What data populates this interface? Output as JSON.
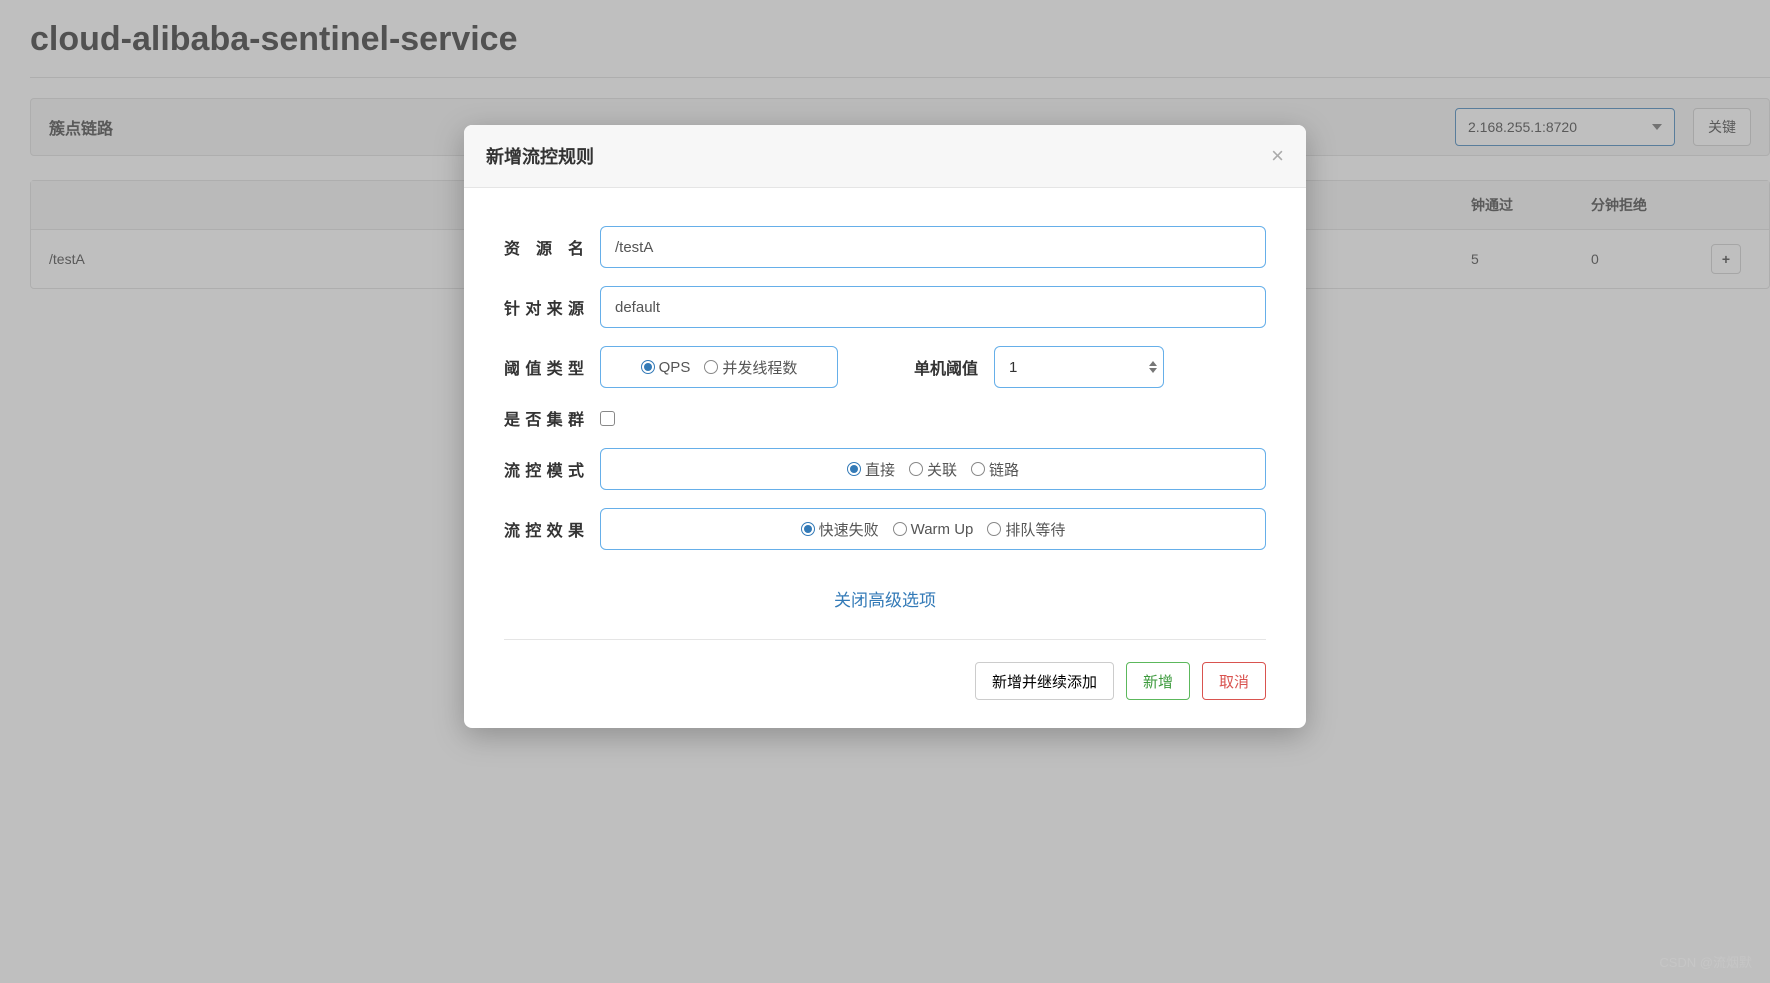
{
  "page": {
    "title": "cloud-alibaba-sentinel-service",
    "section_title": "簇点链路",
    "ip_selected": "2.168.255.1:8720",
    "header_button": "关键",
    "columns": {
      "resource": "",
      "pass": "钟通过",
      "reject": "分钟拒绝"
    },
    "row": {
      "resource": "/testA",
      "pass": "5",
      "reject": "0",
      "action_icon": "+"
    }
  },
  "modal": {
    "title": "新增流控规则",
    "labels": {
      "resource": "资源名",
      "source": "针对来源",
      "threshold_type": "阈值类型",
      "threshold_value": "单机阈值",
      "cluster": "是否集群",
      "mode": "流控模式",
      "effect": "流控效果"
    },
    "values": {
      "resource": "/testA",
      "source": "default",
      "threshold": "1"
    },
    "threshold_type_options": [
      {
        "label": "QPS",
        "checked": true
      },
      {
        "label": "并发线程数",
        "checked": false
      }
    ],
    "mode_options": [
      {
        "label": "直接",
        "checked": true
      },
      {
        "label": "关联",
        "checked": false
      },
      {
        "label": "链路",
        "checked": false
      }
    ],
    "effect_options": [
      {
        "label": "快速失败",
        "checked": true
      },
      {
        "label": "Warm Up",
        "checked": false
      },
      {
        "label": "排队等待",
        "checked": false
      }
    ],
    "toggle_advanced": "关闭高级选项",
    "footer": {
      "add_continue": "新增并继续添加",
      "add": "新增",
      "cancel": "取消"
    }
  },
  "watermark": "CSDN @流烟默"
}
